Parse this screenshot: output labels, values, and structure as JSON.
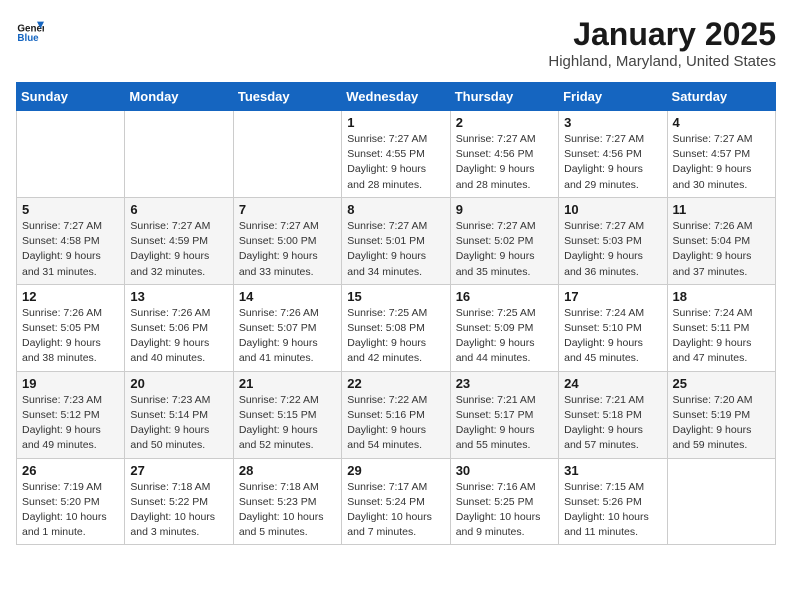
{
  "header": {
    "logo_line1": "General",
    "logo_line2": "Blue",
    "month": "January 2025",
    "location": "Highland, Maryland, United States"
  },
  "weekdays": [
    "Sunday",
    "Monday",
    "Tuesday",
    "Wednesday",
    "Thursday",
    "Friday",
    "Saturday"
  ],
  "weeks": [
    [
      {
        "day": "",
        "info": ""
      },
      {
        "day": "",
        "info": ""
      },
      {
        "day": "",
        "info": ""
      },
      {
        "day": "1",
        "info": "Sunrise: 7:27 AM\nSunset: 4:55 PM\nDaylight: 9 hours\nand 28 minutes."
      },
      {
        "day": "2",
        "info": "Sunrise: 7:27 AM\nSunset: 4:56 PM\nDaylight: 9 hours\nand 28 minutes."
      },
      {
        "day": "3",
        "info": "Sunrise: 7:27 AM\nSunset: 4:56 PM\nDaylight: 9 hours\nand 29 minutes."
      },
      {
        "day": "4",
        "info": "Sunrise: 7:27 AM\nSunset: 4:57 PM\nDaylight: 9 hours\nand 30 minutes."
      }
    ],
    [
      {
        "day": "5",
        "info": "Sunrise: 7:27 AM\nSunset: 4:58 PM\nDaylight: 9 hours\nand 31 minutes."
      },
      {
        "day": "6",
        "info": "Sunrise: 7:27 AM\nSunset: 4:59 PM\nDaylight: 9 hours\nand 32 minutes."
      },
      {
        "day": "7",
        "info": "Sunrise: 7:27 AM\nSunset: 5:00 PM\nDaylight: 9 hours\nand 33 minutes."
      },
      {
        "day": "8",
        "info": "Sunrise: 7:27 AM\nSunset: 5:01 PM\nDaylight: 9 hours\nand 34 minutes."
      },
      {
        "day": "9",
        "info": "Sunrise: 7:27 AM\nSunset: 5:02 PM\nDaylight: 9 hours\nand 35 minutes."
      },
      {
        "day": "10",
        "info": "Sunrise: 7:27 AM\nSunset: 5:03 PM\nDaylight: 9 hours\nand 36 minutes."
      },
      {
        "day": "11",
        "info": "Sunrise: 7:26 AM\nSunset: 5:04 PM\nDaylight: 9 hours\nand 37 minutes."
      }
    ],
    [
      {
        "day": "12",
        "info": "Sunrise: 7:26 AM\nSunset: 5:05 PM\nDaylight: 9 hours\nand 38 minutes."
      },
      {
        "day": "13",
        "info": "Sunrise: 7:26 AM\nSunset: 5:06 PM\nDaylight: 9 hours\nand 40 minutes."
      },
      {
        "day": "14",
        "info": "Sunrise: 7:26 AM\nSunset: 5:07 PM\nDaylight: 9 hours\nand 41 minutes."
      },
      {
        "day": "15",
        "info": "Sunrise: 7:25 AM\nSunset: 5:08 PM\nDaylight: 9 hours\nand 42 minutes."
      },
      {
        "day": "16",
        "info": "Sunrise: 7:25 AM\nSunset: 5:09 PM\nDaylight: 9 hours\nand 44 minutes."
      },
      {
        "day": "17",
        "info": "Sunrise: 7:24 AM\nSunset: 5:10 PM\nDaylight: 9 hours\nand 45 minutes."
      },
      {
        "day": "18",
        "info": "Sunrise: 7:24 AM\nSunset: 5:11 PM\nDaylight: 9 hours\nand 47 minutes."
      }
    ],
    [
      {
        "day": "19",
        "info": "Sunrise: 7:23 AM\nSunset: 5:12 PM\nDaylight: 9 hours\nand 49 minutes."
      },
      {
        "day": "20",
        "info": "Sunrise: 7:23 AM\nSunset: 5:14 PM\nDaylight: 9 hours\nand 50 minutes."
      },
      {
        "day": "21",
        "info": "Sunrise: 7:22 AM\nSunset: 5:15 PM\nDaylight: 9 hours\nand 52 minutes."
      },
      {
        "day": "22",
        "info": "Sunrise: 7:22 AM\nSunset: 5:16 PM\nDaylight: 9 hours\nand 54 minutes."
      },
      {
        "day": "23",
        "info": "Sunrise: 7:21 AM\nSunset: 5:17 PM\nDaylight: 9 hours\nand 55 minutes."
      },
      {
        "day": "24",
        "info": "Sunrise: 7:21 AM\nSunset: 5:18 PM\nDaylight: 9 hours\nand 57 minutes."
      },
      {
        "day": "25",
        "info": "Sunrise: 7:20 AM\nSunset: 5:19 PM\nDaylight: 9 hours\nand 59 minutes."
      }
    ],
    [
      {
        "day": "26",
        "info": "Sunrise: 7:19 AM\nSunset: 5:20 PM\nDaylight: 10 hours\nand 1 minute."
      },
      {
        "day": "27",
        "info": "Sunrise: 7:18 AM\nSunset: 5:22 PM\nDaylight: 10 hours\nand 3 minutes."
      },
      {
        "day": "28",
        "info": "Sunrise: 7:18 AM\nSunset: 5:23 PM\nDaylight: 10 hours\nand 5 minutes."
      },
      {
        "day": "29",
        "info": "Sunrise: 7:17 AM\nSunset: 5:24 PM\nDaylight: 10 hours\nand 7 minutes."
      },
      {
        "day": "30",
        "info": "Sunrise: 7:16 AM\nSunset: 5:25 PM\nDaylight: 10 hours\nand 9 minutes."
      },
      {
        "day": "31",
        "info": "Sunrise: 7:15 AM\nSunset: 5:26 PM\nDaylight: 10 hours\nand 11 minutes."
      },
      {
        "day": "",
        "info": ""
      }
    ]
  ]
}
